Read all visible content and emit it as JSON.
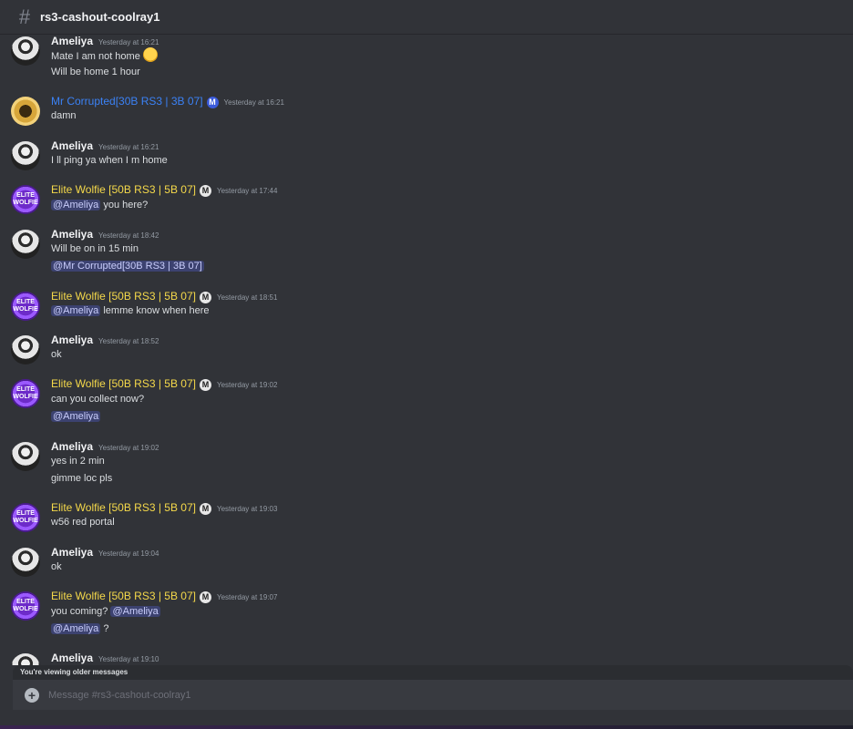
{
  "channel": {
    "name": "rs3-cashout-coolray1"
  },
  "messages": [
    {
      "author": "Ameliya",
      "author_color": "#f2f3f5",
      "timestamp": "Yesterday at 16:21",
      "lines": [
        "Mate I am not home",
        "Will be home 1 hour"
      ],
      "emoji_after_first_line": "weary-face"
    },
    {
      "author": "Mr Corrupted[30B RS3 | 3B 07]",
      "author_color": "#3b82f6",
      "timestamp": "Yesterday at 16:21",
      "lines": [
        "damn"
      ]
    },
    {
      "author": "Ameliya",
      "author_color": "#f2f3f5",
      "timestamp": "Yesterday at 16:21",
      "lines": [
        "I ll ping ya when I m home"
      ]
    },
    {
      "author": "Elite Wolfie [50B RS3 | 5B 07]",
      "author_color": "#f5d94a",
      "timestamp": "Yesterday at 17:44",
      "mention": "@Ameliya",
      "text": "you here?"
    },
    {
      "author": "Ameliya",
      "author_color": "#f2f3f5",
      "timestamp": "Yesterday at 18:42",
      "lines": [
        "Will be on in 15 min"
      ],
      "mention_line": "@Mr Corrupted[30B RS3 | 3B 07]"
    },
    {
      "author": "Elite Wolfie [50B RS3 | 5B 07]",
      "author_color": "#f5d94a",
      "timestamp": "Yesterday at 18:51",
      "mention": "@Ameliya",
      "text": "lemme know when here"
    },
    {
      "author": "Ameliya",
      "author_color": "#f2f3f5",
      "timestamp": "Yesterday at 18:52",
      "lines": [
        "ok"
      ]
    },
    {
      "author": "Elite Wolfie [50B RS3 | 5B 07]",
      "author_color": "#f5d94a",
      "timestamp": "Yesterday at 19:02",
      "lines": [
        "can you collect now?"
      ],
      "mention_line": "@Ameliya"
    },
    {
      "author": "Ameliya",
      "author_color": "#f2f3f5",
      "timestamp": "Yesterday at 19:02",
      "lines": [
        "yes in 2 min",
        "gimme loc pls"
      ]
    },
    {
      "author": "Elite Wolfie [50B RS3 | 5B 07]",
      "author_color": "#f5d94a",
      "timestamp": "Yesterday at 19:03",
      "lines": [
        "w56 red portal"
      ]
    },
    {
      "author": "Ameliya",
      "author_color": "#f2f3f5",
      "timestamp": "Yesterday at 19:04",
      "lines": [
        "ok"
      ]
    },
    {
      "author": "Elite Wolfie [50B RS3 | 5B 07]",
      "author_color": "#f5d94a",
      "timestamp": "Yesterday at 19:07",
      "text": "you coming?",
      "mention": "@Ameliya",
      "line2_mention": "@Ameliya",
      "line2_text": "?"
    },
    {
      "author": "Ameliya",
      "author_color": "#f2f3f5",
      "timestamp": "Yesterday at 19:10"
    }
  ],
  "avatar_text": "ELITE WOLFIE",
  "badges": {
    "wolfie": "M",
    "mr": "M"
  },
  "older_notice": "You're viewing older messages",
  "composer": {
    "placeholder": "Message #rs3-cashout-coolray1"
  },
  "icons": {
    "channel": "hash-icon",
    "add": "plus-circle-icon"
  }
}
